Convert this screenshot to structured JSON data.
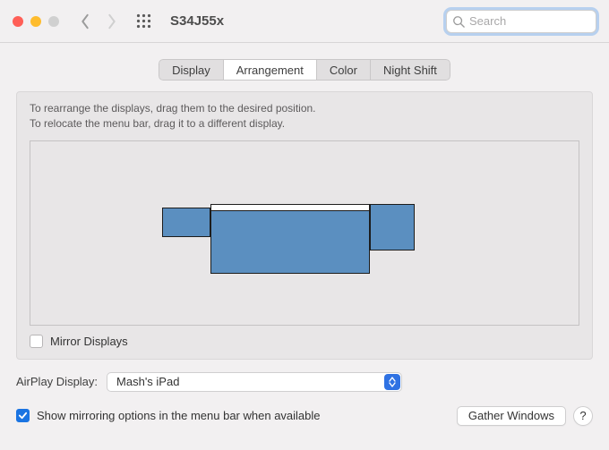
{
  "window": {
    "title": "S34J55x",
    "search_placeholder": "Search"
  },
  "tabs": [
    {
      "label": "Display"
    },
    {
      "label": "Arrangement"
    },
    {
      "label": "Color"
    },
    {
      "label": "Night Shift"
    }
  ],
  "instructions": {
    "line1": "To rearrange the displays, drag them to the desired position.",
    "line2": "To relocate the menu bar, drag it to a different display."
  },
  "mirror_displays": {
    "label": "Mirror Displays",
    "checked": false
  },
  "airplay": {
    "label": "AirPlay Display:",
    "selected": "Mash's iPad"
  },
  "show_mirroring": {
    "label": "Show mirroring options in the menu bar when available",
    "checked": true
  },
  "gather_windows_label": "Gather Windows",
  "help_label": "?"
}
